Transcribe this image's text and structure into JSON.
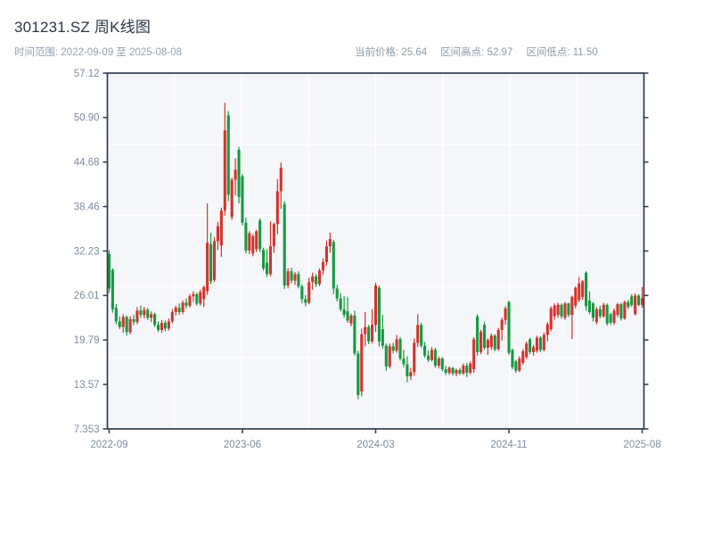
{
  "header": {
    "title": "301231.SZ 周K线图",
    "subtitle": "时间范围: 2022-09-09 至 2025-08-08",
    "stats": [
      {
        "text": "当前价格: 25.64"
      },
      {
        "text": "区间高点: 52.97"
      },
      {
        "text": "区间低点: 11.50"
      }
    ]
  },
  "colors": {
    "frame": "#2e3c52",
    "grid": "#ffffff",
    "plot_bg": "#f4f6fa",
    "axis_label": "#7d8ba0",
    "title": "#2a3545",
    "subtitle": "#94a1b3"
  },
  "chart_data": {
    "type": "candlestick",
    "title": "301231.SZ 周K线图",
    "interval": "weekly",
    "current_price": 25.64,
    "range_high": 52.97,
    "range_low": 11.5,
    "y_min": 7.353,
    "y_max": 57.12,
    "y_tick_labels": [
      "57.12",
      "50.90",
      "44.68",
      "38.46",
      "32.23",
      "26.01",
      "19.79",
      "13.57",
      "7.353"
    ],
    "x_tick_labels": [
      "2022-09",
      "2023-06",
      "2024-03",
      "2024-11",
      "2025-08"
    ],
    "x_tick_indices": [
      0,
      38,
      76,
      114,
      152
    ],
    "grid": {
      "v_divisions": 8,
      "h_divisions": 5
    },
    "up_color": "#d2342c",
    "down_color": "#17993f",
    "candles_format": [
      "open",
      "high",
      "low",
      "close"
    ],
    "candles": [
      [
        31.8,
        32.3,
        26.4,
        27.0
      ],
      [
        29.6,
        29.8,
        23.6,
        24.1
      ],
      [
        24.3,
        24.8,
        22.0,
        22.4
      ],
      [
        22.4,
        23.1,
        21.3,
        21.6
      ],
      [
        21.6,
        23.4,
        20.8,
        23.0
      ],
      [
        23.0,
        23.2,
        20.4,
        20.9
      ],
      [
        20.9,
        23.1,
        20.6,
        22.7
      ],
      [
        22.7,
        23.3,
        21.9,
        22.3
      ],
      [
        22.3,
        24.4,
        22.0,
        23.9
      ],
      [
        23.9,
        24.6,
        22.9,
        23.3
      ],
      [
        23.3,
        24.4,
        22.8,
        24.0
      ],
      [
        24.0,
        24.3,
        22.6,
        22.9
      ],
      [
        22.9,
        23.8,
        22.3,
        23.4
      ],
      [
        23.4,
        23.6,
        21.6,
        21.9
      ],
      [
        21.9,
        22.4,
        20.9,
        21.2
      ],
      [
        21.2,
        22.6,
        20.8,
        22.2
      ],
      [
        22.2,
        22.5,
        21.0,
        21.4
      ],
      [
        21.4,
        22.8,
        21.1,
        22.4
      ],
      [
        22.4,
        24.1,
        22.1,
        23.7
      ],
      [
        23.7,
        24.6,
        23.2,
        24.3
      ],
      [
        24.3,
        24.9,
        23.3,
        23.7
      ],
      [
        23.7,
        25.3,
        23.4,
        25.0
      ],
      [
        25.0,
        25.6,
        24.2,
        24.6
      ],
      [
        24.6,
        26.2,
        24.3,
        25.9
      ],
      [
        25.9,
        26.6,
        25.1,
        26.2
      ],
      [
        26.2,
        26.4,
        24.6,
        24.9
      ],
      [
        24.9,
        26.8,
        24.6,
        26.5
      ],
      [
        25.5,
        27.4,
        24.4,
        27.2
      ],
      [
        26.6,
        38.9,
        26.1,
        33.4
      ],
      [
        33.2,
        34.8,
        27.6,
        28.0
      ],
      [
        28.2,
        34.2,
        27.9,
        33.6
      ],
      [
        33.6,
        36.3,
        32.4,
        35.7
      ],
      [
        33.0,
        38.3,
        31.4,
        37.9
      ],
      [
        37.9,
        52.97,
        37.2,
        49.1
      ],
      [
        51.2,
        51.8,
        39.2,
        40.1
      ],
      [
        37.0,
        42.5,
        36.6,
        42.2
      ],
      [
        42.2,
        45.2,
        40.0,
        43.6
      ],
      [
        46.4,
        46.8,
        38.9,
        39.8
      ],
      [
        42.7,
        43.0,
        35.8,
        36.2
      ],
      [
        36.2,
        36.9,
        31.9,
        32.3
      ],
      [
        32.3,
        35.0,
        31.8,
        34.7
      ],
      [
        31.9,
        34.6,
        31.5,
        34.3
      ],
      [
        32.5,
        35.2,
        32.1,
        35.0
      ],
      [
        36.5,
        36.8,
        32.1,
        32.5
      ],
      [
        32.4,
        32.7,
        29.5,
        29.8
      ],
      [
        30.6,
        32.5,
        28.6,
        29.0
      ],
      [
        29.0,
        36.4,
        28.7,
        32.9
      ],
      [
        32.9,
        36.2,
        32.0,
        36.0
      ],
      [
        36.0,
        42.3,
        34.6,
        40.6
      ],
      [
        40.6,
        44.6,
        38.1,
        43.9
      ],
      [
        38.8,
        39.2,
        26.9,
        27.4
      ],
      [
        27.4,
        29.8,
        27.0,
        29.4
      ],
      [
        29.4,
        29.9,
        27.7,
        28.1
      ],
      [
        28.1,
        29.3,
        27.5,
        29.0
      ],
      [
        29.0,
        29.4,
        27.0,
        27.3
      ],
      [
        27.3,
        27.6,
        24.9,
        25.5
      ],
      [
        25.5,
        26.1,
        24.5,
        25.0
      ],
      [
        25.0,
        28.5,
        24.8,
        27.9
      ],
      [
        27.9,
        29.2,
        26.8,
        28.7
      ],
      [
        28.7,
        29.0,
        27.2,
        27.6
      ],
      [
        27.6,
        29.8,
        27.3,
        29.5
      ],
      [
        29.5,
        31.2,
        28.9,
        30.7
      ],
      [
        30.7,
        33.7,
        30.2,
        32.9
      ],
      [
        32.9,
        34.8,
        32.0,
        33.9
      ],
      [
        33.5,
        33.8,
        26.2,
        27.0
      ],
      [
        27.0,
        27.5,
        25.2,
        25.6
      ],
      [
        25.6,
        26.3,
        23.8,
        24.1
      ],
      [
        24.1,
        25.9,
        22.9,
        23.3
      ],
      [
        23.8,
        25.8,
        22.2,
        22.5
      ],
      [
        22.1,
        23.5,
        21.7,
        23.2
      ],
      [
        23.2,
        23.9,
        17.6,
        17.9
      ],
      [
        17.9,
        18.3,
        11.5,
        12.1
      ],
      [
        12.6,
        21.4,
        11.9,
        20.6
      ],
      [
        20.6,
        23.7,
        18.9,
        21.6
      ],
      [
        21.6,
        21.9,
        19.2,
        19.6
      ],
      [
        19.6,
        24.1,
        19.3,
        21.9
      ],
      [
        21.9,
        27.8,
        20.9,
        27.4
      ],
      [
        27.1,
        27.4,
        18.9,
        19.6
      ],
      [
        21.3,
        23.3,
        18.6,
        19.0
      ],
      [
        19.0,
        19.3,
        15.5,
        16.1
      ],
      [
        16.1,
        19.3,
        15.8,
        18.9
      ],
      [
        18.9,
        19.4,
        17.9,
        18.3
      ],
      [
        18.3,
        20.5,
        18.0,
        19.9
      ],
      [
        19.9,
        20.2,
        16.9,
        17.2
      ],
      [
        17.2,
        18.4,
        16.0,
        16.4
      ],
      [
        16.4,
        17.5,
        13.9,
        14.7
      ],
      [
        14.7,
        15.9,
        14.2,
        15.3
      ],
      [
        15.3,
        20.0,
        14.8,
        19.4
      ],
      [
        19.4,
        23.4,
        18.8,
        21.9
      ],
      [
        21.9,
        22.2,
        18.7,
        19.0
      ],
      [
        19.0,
        19.5,
        17.3,
        17.6
      ],
      [
        17.6,
        18.3,
        16.7,
        17.0
      ],
      [
        17.0,
        18.8,
        16.8,
        18.4
      ],
      [
        18.4,
        18.7,
        15.9,
        16.2
      ],
      [
        16.2,
        17.5,
        15.8,
        17.2
      ],
      [
        17.2,
        17.4,
        15.4,
        15.7
      ],
      [
        15.7,
        16.2,
        14.9,
        15.2
      ],
      [
        15.2,
        16.1,
        14.9,
        15.9
      ],
      [
        15.9,
        16.0,
        14.8,
        15.1
      ],
      [
        15.1,
        15.8,
        14.7,
        15.6
      ],
      [
        15.6,
        15.9,
        14.9,
        15.1
      ],
      [
        15.1,
        16.5,
        14.9,
        16.2
      ],
      [
        16.2,
        16.6,
        14.6,
        15.2
      ],
      [
        15.2,
        16.8,
        15.0,
        16.5
      ],
      [
        15.7,
        20.2,
        15.2,
        19.9
      ],
      [
        23.1,
        23.4,
        17.6,
        18.1
      ],
      [
        18.1,
        21.2,
        17.8,
        20.9
      ],
      [
        21.9,
        22.3,
        18.4,
        18.7
      ],
      [
        18.7,
        20.0,
        17.7,
        19.8
      ],
      [
        18.8,
        20.7,
        18.4,
        20.4
      ],
      [
        20.4,
        20.6,
        18.2,
        18.5
      ],
      [
        18.5,
        21.5,
        18.3,
        21.2
      ],
      [
        21.2,
        22.9,
        19.7,
        22.6
      ],
      [
        22.6,
        24.5,
        21.9,
        24.2
      ],
      [
        25.1,
        25.3,
        17.7,
        18.0
      ],
      [
        18.4,
        18.6,
        15.7,
        16.0
      ],
      [
        16.8,
        17.0,
        15.2,
        15.5
      ],
      [
        15.5,
        17.5,
        15.3,
        17.2
      ],
      [
        16.6,
        18.5,
        16.3,
        18.2
      ],
      [
        17.4,
        19.6,
        17.1,
        19.3
      ],
      [
        19.9,
        20.1,
        17.8,
        18.1
      ],
      [
        18.1,
        19.1,
        17.6,
        18.8
      ],
      [
        18.3,
        20.4,
        18.0,
        20.1
      ],
      [
        20.1,
        20.3,
        18.1,
        18.4
      ],
      [
        18.4,
        20.8,
        18.2,
        20.5
      ],
      [
        20.5,
        22.3,
        19.6,
        22.0
      ],
      [
        21.3,
        24.5,
        21.0,
        24.2
      ],
      [
        23.1,
        24.9,
        22.6,
        24.6
      ],
      [
        23.3,
        25.0,
        22.9,
        24.7
      ],
      [
        24.7,
        24.9,
        22.8,
        23.1
      ],
      [
        22.9,
        25.1,
        22.6,
        24.9
      ],
      [
        24.9,
        25.0,
        23.0,
        23.3
      ],
      [
        23.3,
        26.0,
        19.9,
        25.8
      ],
      [
        24.6,
        27.3,
        24.2,
        27.1
      ],
      [
        25.4,
        28.6,
        25.1,
        27.7
      ],
      [
        25.8,
        28.2,
        25.4,
        28.0
      ],
      [
        29.2,
        29.4,
        23.9,
        24.5
      ],
      [
        25.3,
        26.6,
        23.4,
        23.7
      ],
      [
        24.9,
        25.1,
        22.4,
        22.9
      ],
      [
        22.3,
        24.4,
        22.0,
        24.1
      ],
      [
        24.1,
        24.6,
        22.8,
        23.1
      ],
      [
        23.1,
        25.0,
        22.9,
        24.7
      ],
      [
        24.7,
        24.9,
        21.8,
        22.1
      ],
      [
        23.4,
        23.6,
        21.9,
        22.2
      ],
      [
        22.2,
        24.2,
        21.9,
        23.9
      ],
      [
        23.3,
        25.0,
        23.0,
        24.8
      ],
      [
        24.8,
        25.0,
        22.5,
        22.8
      ],
      [
        22.8,
        25.3,
        22.6,
        25.1
      ],
      [
        25.1,
        25.4,
        24.1,
        24.4
      ],
      [
        25.9,
        26.2,
        24.4,
        24.7
      ],
      [
        23.4,
        26.3,
        23.2,
        26.0
      ],
      [
        26.0,
        26.2,
        24.5,
        24.7
      ],
      [
        24.7,
        27.2,
        24.3,
        25.64
      ]
    ]
  }
}
